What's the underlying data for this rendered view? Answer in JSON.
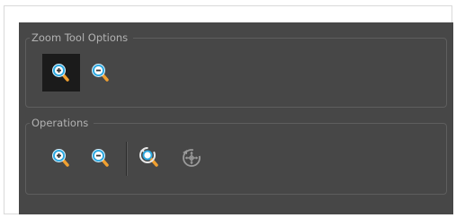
{
  "zoom_tool_options": {
    "title": "Zoom Tool Options",
    "buttons": [
      {
        "name": "zoom-in-mode",
        "icon": "zoom-in-icon",
        "active": true
      },
      {
        "name": "zoom-out-mode",
        "icon": "zoom-out-icon",
        "active": false
      }
    ]
  },
  "operations": {
    "title": "Operations",
    "buttons": [
      {
        "name": "zoom-in",
        "icon": "zoom-in-icon"
      },
      {
        "name": "zoom-out",
        "icon": "zoom-out-icon"
      },
      {
        "name": "reset-zoom",
        "icon": "reset-zoom-icon"
      },
      {
        "name": "reset-view",
        "icon": "reset-view-icon"
      }
    ]
  },
  "colors": {
    "panel_bg": "#474747",
    "active_button_bg": "#1b1b1b",
    "lens_blue": "#2ba8e0",
    "handle_orange": "#f0a030"
  }
}
